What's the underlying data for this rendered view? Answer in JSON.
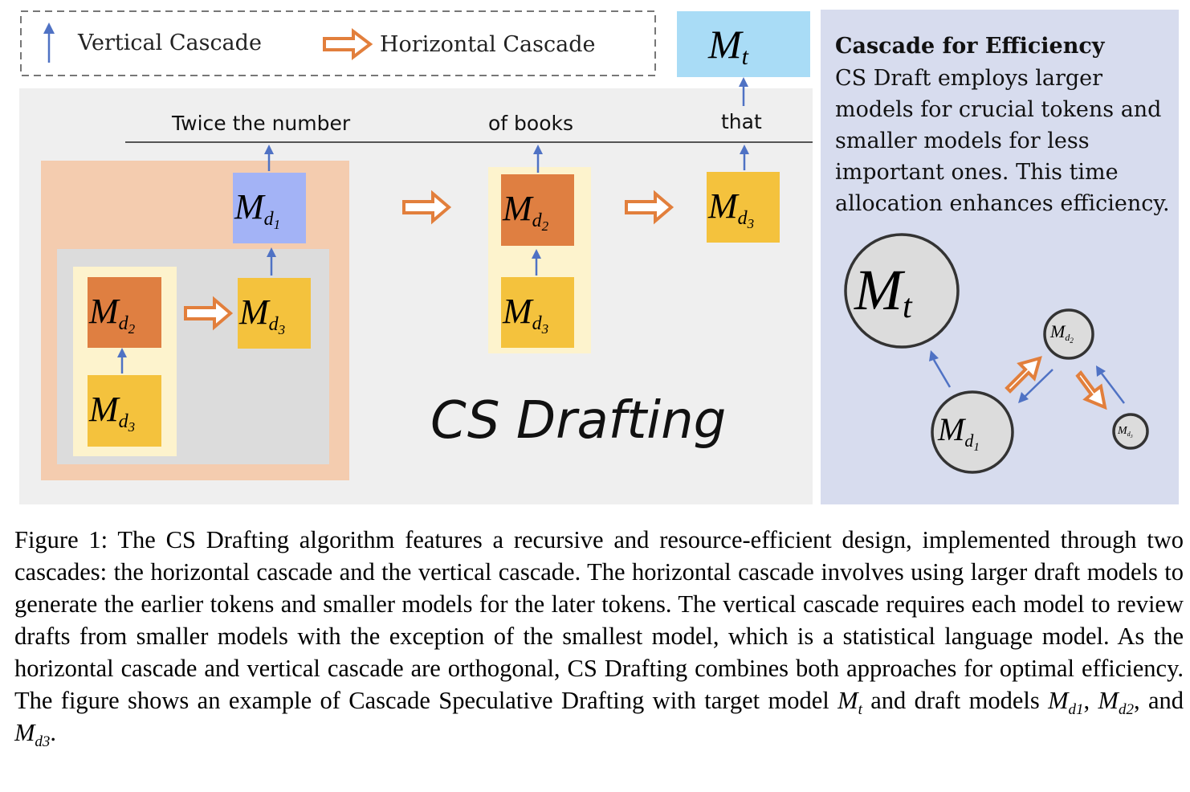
{
  "legend": {
    "vertical_label": "Vertical Cascade",
    "horizontal_label": "Horizontal Cascade"
  },
  "target_model": {
    "symbol": "M",
    "sub": "t"
  },
  "tokens": [
    "Twice the number",
    "of books",
    "that"
  ],
  "models": {
    "d1": {
      "symbol": "M",
      "sub": "d",
      "subsub": "1"
    },
    "d2": {
      "symbol": "M",
      "sub": "d",
      "subsub": "2"
    },
    "d3": {
      "symbol": "M",
      "sub": "d",
      "subsub": "3"
    }
  },
  "title": "CS Drafting",
  "efficiency_panel": {
    "heading": "Cascade for Efficiency",
    "lines": [
      "CS Draft employs larger",
      "models for crucial tokens and",
      "smaller models for less",
      "important ones. This time",
      "allocation enhances efficiency."
    ]
  },
  "caption": {
    "text": "Figure 1: The CS Drafting algorithm features a recursive and resource-efficient design, implemented through two cascades: the horizontal cascade and the vertical cascade. The horizontal cascade involves using larger draft models to generate the earlier tokens and smaller models for the later tokens. The vertical cascade requires each model to review drafts from smaller models with the exception of the smallest model, which is a statistical language model. As the horizontal cascade and vertical cascade are orthogonal, CS Drafting combines both approaches for optimal efficiency. The figure shows an example of Cascade Speculative Drafting with target model ",
    "mid1": " and draft models ",
    "sep1": ", ",
    "sep2": ", and ",
    "end": "."
  },
  "colors": {
    "target": "#a9dcf6",
    "d1": "#a3b3f6",
    "d2": "#df7f41",
    "d3": "#f4c23d",
    "arrow_blue": "#4f72c4",
    "arrow_orange": "#e27f3c",
    "panel_right": "#d7dcee",
    "panel_main": "#efefef",
    "outer_box": "#f4ccaf",
    "inner_box": "#dcdcdc",
    "cream": "#fdf3cd"
  }
}
